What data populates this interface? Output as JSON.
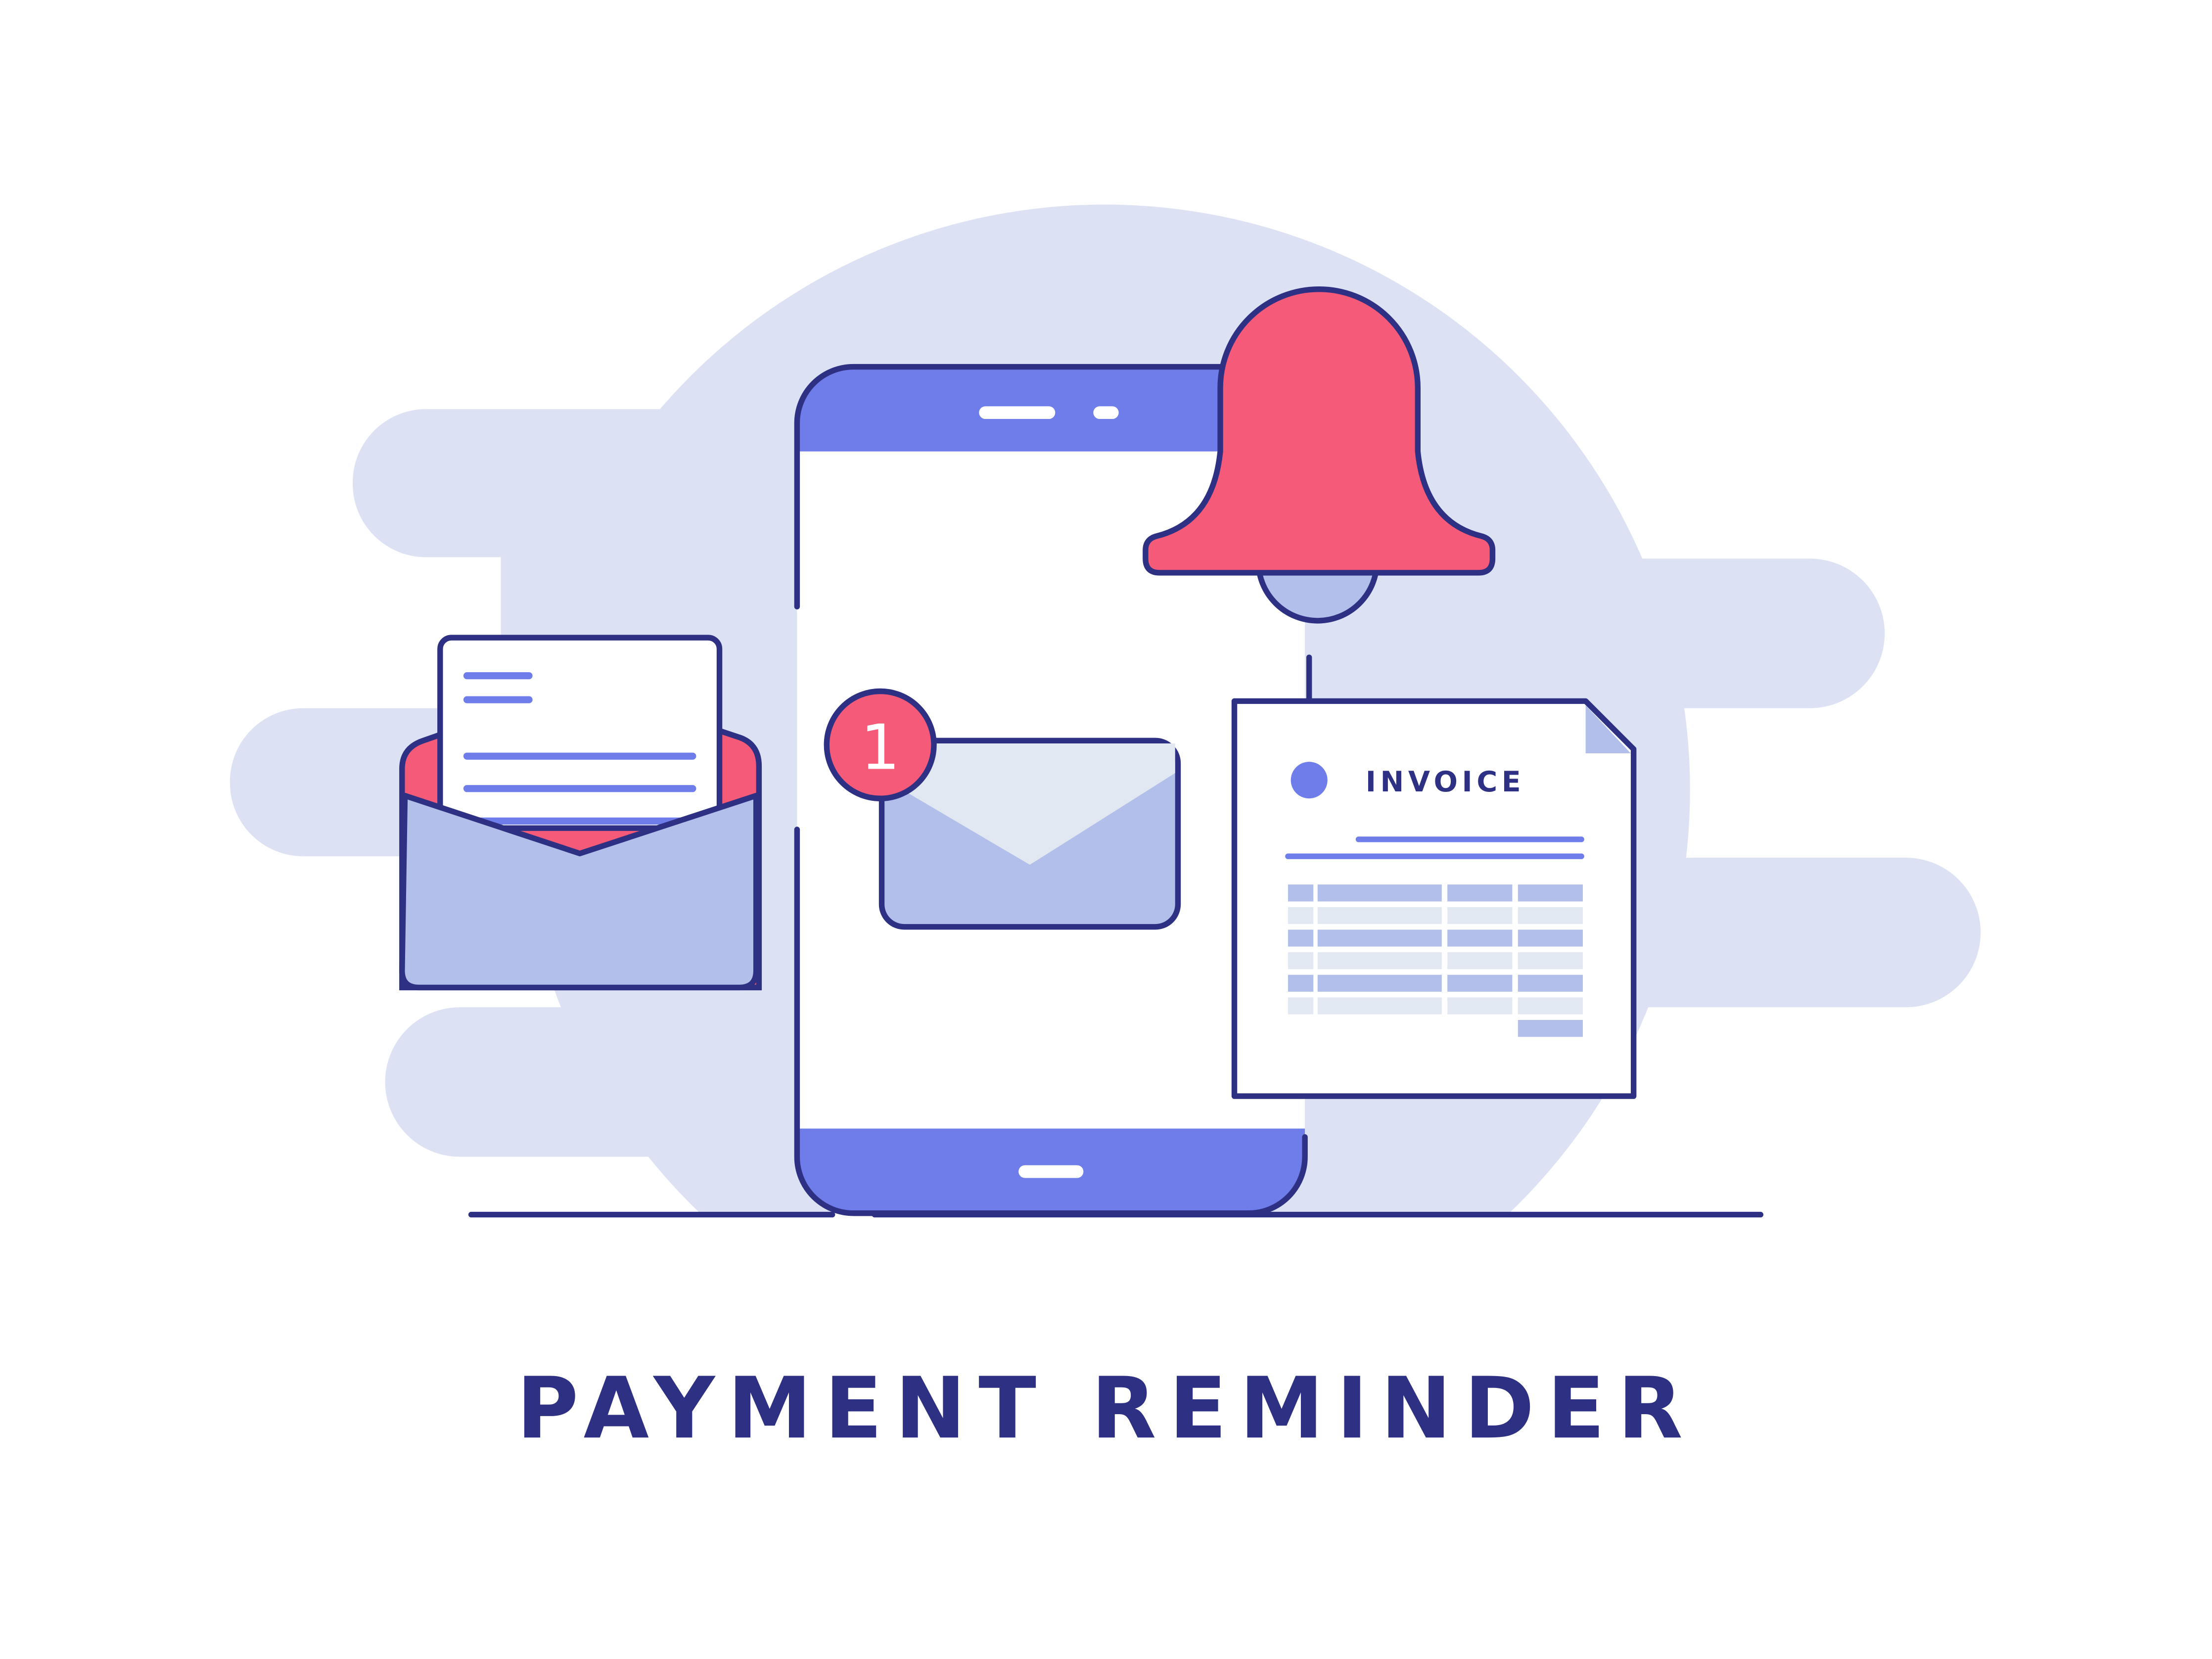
{
  "title": "PAYMENT REMINDER",
  "invoice": {
    "label": "INVOICE"
  },
  "notification_badge": {
    "count": "1"
  },
  "colors": {
    "background_blob": "#dce2f4",
    "outline": "#2e3183",
    "accent_blue": "#6f7deb",
    "bell_pink": "#f55a78",
    "light_blue": "#b1bfea",
    "light_gray": "#e2e8f1"
  }
}
